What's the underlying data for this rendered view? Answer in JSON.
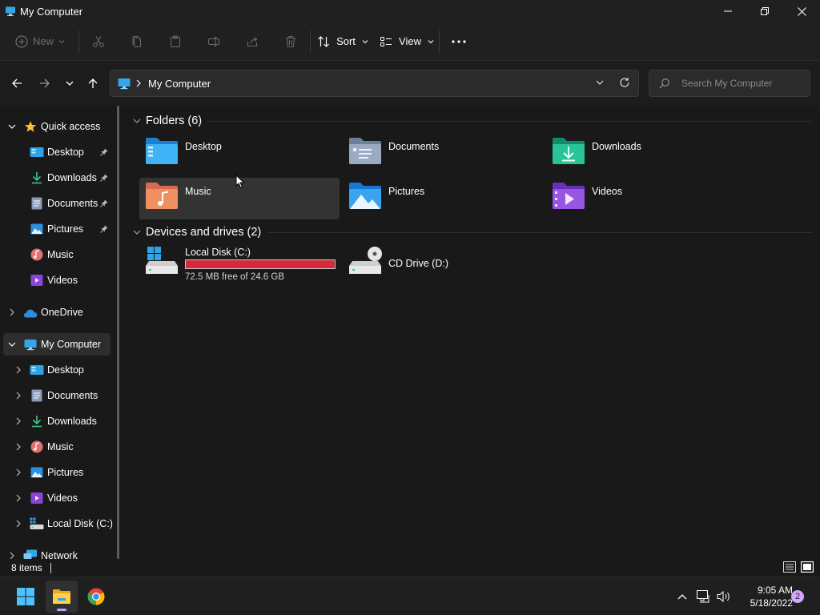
{
  "window": {
    "title": "My Computer",
    "controls": [
      "minimize",
      "maximize",
      "close"
    ]
  },
  "commandbar": {
    "new_label": "New",
    "sort_label": "Sort",
    "view_label": "View",
    "icons": [
      "cut-icon",
      "copy-icon",
      "paste-icon",
      "rename-icon",
      "share-icon",
      "delete-icon",
      "more-icon"
    ]
  },
  "address": {
    "crumb": "My Computer",
    "search_placeholder": "Search My Computer"
  },
  "sidebar": {
    "quick_access": "Quick access",
    "qa_items": [
      {
        "label": "Desktop",
        "pinned": true
      },
      {
        "label": "Downloads",
        "pinned": true
      },
      {
        "label": "Documents",
        "pinned": true
      },
      {
        "label": "Pictures",
        "pinned": true
      },
      {
        "label": "Music",
        "pinned": false
      },
      {
        "label": "Videos",
        "pinned": false
      }
    ],
    "onedrive": "OneDrive",
    "my_computer": "My Computer",
    "mc_items": [
      "Desktop",
      "Documents",
      "Downloads",
      "Music",
      "Pictures",
      "Videos",
      "Local Disk (C:)"
    ],
    "network": "Network"
  },
  "content": {
    "folders_header": "Folders (6)",
    "folders": [
      "Desktop",
      "Documents",
      "Downloads",
      "Music",
      "Pictures",
      "Videos"
    ],
    "devices_header": "Devices and drives (2)",
    "drives": [
      {
        "label": "Local Disk (C:)",
        "free_text": "72.5 MB free of 24.6 GB",
        "used_fraction": 0.997
      },
      {
        "label": "CD Drive (D:)"
      }
    ]
  },
  "status": {
    "item_count": "8 items"
  },
  "taskbar": {
    "time": "9:05 AM",
    "date": "5/18/2022",
    "notifications": "2"
  },
  "colors": {
    "drive_bar_full": "#d42a3a",
    "accent": "#4cc2ff",
    "badge": "#d6a5ff"
  }
}
